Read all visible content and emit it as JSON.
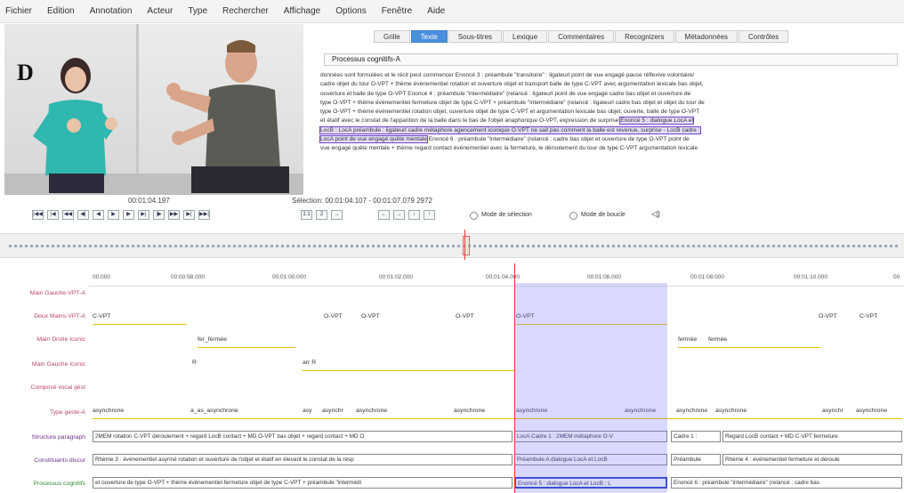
{
  "menu": [
    "Fichier",
    "Edition",
    "Annotation",
    "Acteur",
    "Type",
    "Rechercher",
    "Affichage",
    "Options",
    "Fenêtre",
    "Aide"
  ],
  "video": {
    "panel_letter": "D",
    "time": "00:01:04.197",
    "selection": "Sélection: 00:01:04.107 - 00:01:07.079 2972"
  },
  "controls": {
    "mode_selection": "Mode de sélection",
    "mode_boucle": "Mode de boucle",
    "zoom_a": "1:1",
    "zoom_b": "2"
  },
  "tabs": [
    "Grille",
    "Texte",
    "Sous-titres",
    "Lexique",
    "Commentaires",
    "Recognizers",
    "Métadonnées",
    "Contrôles"
  ],
  "active_tab": "Texte",
  "tier_title": "Processus cognitifs-A",
  "text_lines": [
    "données sont formulées et le récit peut commencer    Enoncé 3 : préambule \"transitoire\" : ligateurl point de vue engagé pause réflexive volontaire/",
    "cadre objet du tour O-VPT + thème événementiel rotation et ouverture objet et transport balle de type C-VPT avec argumentation lexicale bas objet,",
    "ouverture et balle de type O-VPT    Enoncé 4 : préambule \"intermédiaire\" (relancé : ligateurl point de vue engagé cadre bas objet et ouverture de",
    "type O-VPT + thème événementiel fermeture objet de type C-VPT + préambule \"intermédiaire\" (relancé : ligateurl cadre bas objet et objet du tour de",
    "type O-VPT + thème événementiel rotation objet, ouverture objet de type C-VPT et argumentation lexicale bas objet, ouverte, balle de type O-VPT",
    "et étatif avec le constat de l'apparition de la balle dans le bas de l'objet anaphorique O-VPT, expression de surprise"
  ],
  "highlight": {
    "a": "Enoncé 5 : dialogue LocA et",
    "b": "LocB : LocA préambule : ligateurl cadre métaphore agencement iconique O-VPT ne sait pas comment la balle est revenue, surprise - LocB cadre :",
    "c": "LocA point de vue engagé quête mentale"
  },
  "text_tail_5": "",
  "text_tail_7": "Enoncé 6 : préambule \"intermédiaire\" (relancé : cadre bas objet et ouverture de type O-VPT point de",
  "text_line_8": "vue engagé quête mentale + thème regard contact événementiel avec la fermeture, le déroulement du tour de type C-VPT argumentation lexicale",
  "ruler": [
    "00.000",
    "00:00:58.000",
    "00:01:00.000",
    "00:01:02.000",
    "00:01:04.000",
    "00:01:06.000",
    "00:01:08.000",
    "00:01:10.000",
    "00"
  ],
  "tiers": [
    "Main Gauche-VPT-A",
    "Deux Mains-VPT-A",
    "Main Droite Iconic",
    "Main Gauche Iconic",
    "Composé vocal gèst",
    "Type geste-A",
    "Structure paragraph",
    "Constituants discur",
    "Processus cognitifs"
  ],
  "row1": [
    "C-VPT",
    "O-VPT",
    "O-VPT",
    "O-VPT",
    "O-VPT",
    "O-VPT",
    "C-VPT"
  ],
  "row2": [
    "fer_fermée",
    "fermée",
    "fermée"
  ],
  "row3": [
    "R",
    "arr R"
  ],
  "row5": [
    "asynchrone",
    "a_as_asynchrone",
    "asy",
    "asynchr",
    "asynchrone",
    "asynchrone",
    "asynchrone",
    "asynchrone",
    "asynchrone",
    "asynchrone",
    "asynchrone",
    "asynchr",
    "asynchrone"
  ],
  "row6": [
    "2MEM rotation C-VPT déroulement + regard LocB contact + MD O-VPT bas objet + regard contact + MD O",
    "LocA Cadre 1 : 2MEM métaphore O-V",
    "Cadre 1 :",
    "Regard LocB contact + MD C-VPT fermeture"
  ],
  "row7": [
    "Rhème 3 : événementiel asyriné rotation et ouverture de l'objet et étatif en élevant le constat de la résp",
    "Préambule A dialogue LocA et LocB",
    "Préambule",
    "Rhème 4 : événementiel fermeture et déroule"
  ],
  "row8": [
    "et ouverture de type O-VPT + thème événementiel fermeture objet de type C-VPT + préambule \"intermédi",
    "Enoncé 5 : dialogue LocA et LocB : L",
    "Enoncé 6 : préambule \"intermédiaire\" (relancé : cadre bas"
  ],
  "colors": {
    "active_tab": "#4a8fdc",
    "cursor": "#e33333",
    "selection": "#7878ff",
    "highlight": "#7040c8",
    "tier_label": "#bb4466"
  }
}
